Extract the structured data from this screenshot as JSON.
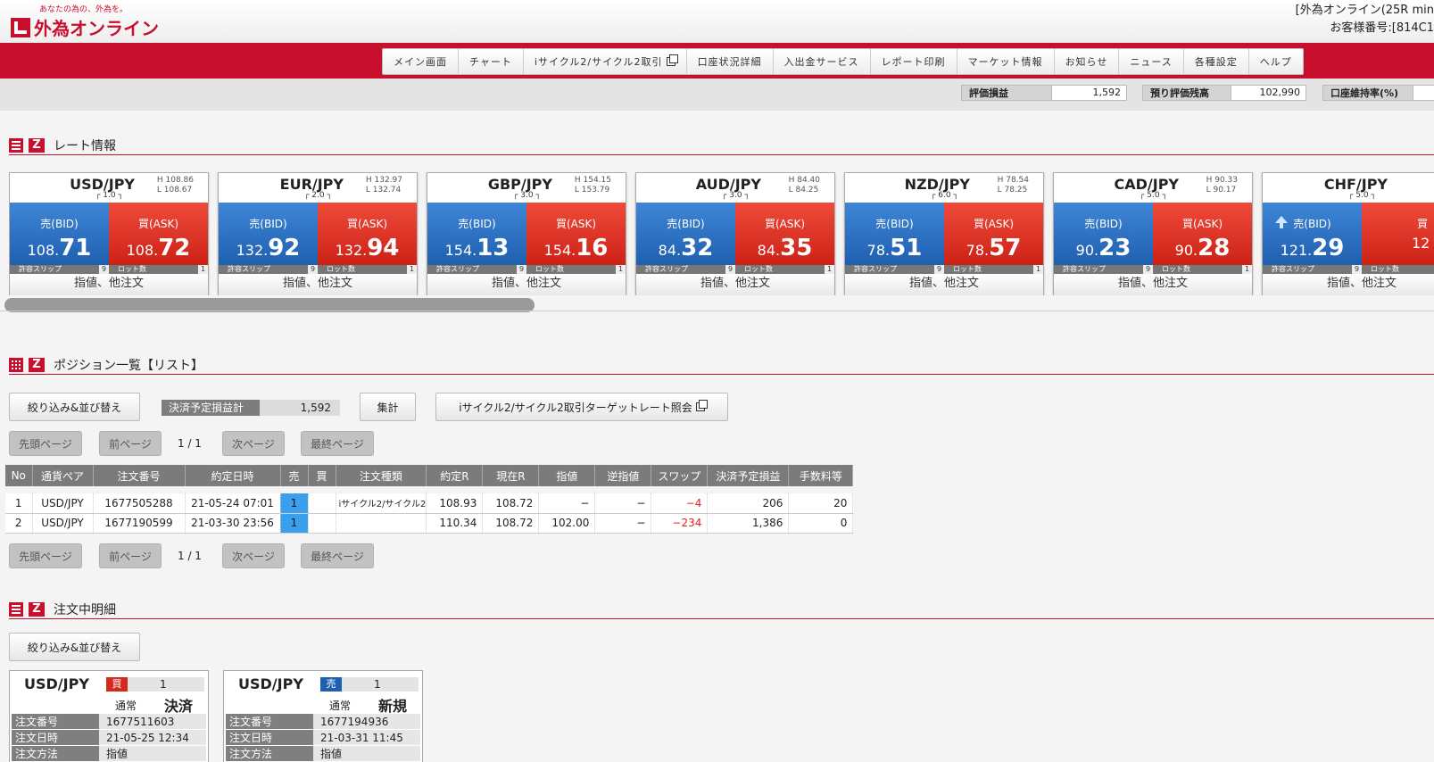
{
  "header": {
    "tagline": "あなたの為の、外為を。",
    "logo_text": "外為オンライン",
    "account_line1": "[外為オンライン(25R min",
    "account_line2": "お客様番号:[814C1"
  },
  "nav": {
    "items": [
      "メイン画面",
      "チャート",
      "iサイクル2/サイクル2取引",
      "口座状況詳細",
      "入出金サービス",
      "レポート印刷",
      "マーケット情報",
      "お知らせ",
      "ニュース",
      "各種設定",
      "ヘルプ"
    ]
  },
  "summary": {
    "pl_label": "評価損益",
    "pl_value": "1,592",
    "balance_label": "預り評価残高",
    "balance_value": "102,990",
    "margin_label": "口座維持率(%)"
  },
  "rates": {
    "title": "レート情報",
    "bid_label": "売(BID)",
    "ask_label": "買(ASK)",
    "slip_label": "許容スリップ",
    "lot_label": "ロット数",
    "order_link": "指値、他注文",
    "cards": [
      {
        "pair": "USD/JPY",
        "high": "H 108.86",
        "low": "L 108.67",
        "spread": "1.0",
        "bid_int": "108.",
        "bid_dec": "71",
        "ask_int": "108.",
        "ask_dec": "72",
        "slip": "9",
        "lot": "1"
      },
      {
        "pair": "EUR/JPY",
        "high": "H 132.97",
        "low": "L 132.74",
        "spread": "2.0",
        "bid_int": "132.",
        "bid_dec": "92",
        "ask_int": "132.",
        "ask_dec": "94",
        "slip": "9",
        "lot": "1"
      },
      {
        "pair": "GBP/JPY",
        "high": "H 154.15",
        "low": "L 153.79",
        "spread": "3.0",
        "bid_int": "154.",
        "bid_dec": "13",
        "ask_int": "154.",
        "ask_dec": "16",
        "slip": "9",
        "lot": "1"
      },
      {
        "pair": "AUD/JPY",
        "high": "H 84.40",
        "low": "L 84.25",
        "spread": "3.0",
        "bid_int": "84.",
        "bid_dec": "32",
        "ask_int": "84.",
        "ask_dec": "35",
        "slip": "9",
        "lot": "1"
      },
      {
        "pair": "NZD/JPY",
        "high": "H 78.54",
        "low": "L 78.25",
        "spread": "6.0",
        "bid_int": "78.",
        "bid_dec": "51",
        "ask_int": "78.",
        "ask_dec": "57",
        "slip": "9",
        "lot": "1"
      },
      {
        "pair": "CAD/JPY",
        "high": "H 90.33",
        "low": "L 90.17",
        "spread": "5.0",
        "bid_int": "90.",
        "bid_dec": "23",
        "ask_int": "90.",
        "ask_dec": "28",
        "slip": "9",
        "lot": "1"
      },
      {
        "pair": "CHF/JPY",
        "high": "",
        "low": "",
        "spread": "5.0",
        "bid_int": "121.",
        "bid_dec": "29",
        "ask_int": "12",
        "ask_dec": "",
        "slip": "9",
        "lot": "1"
      }
    ]
  },
  "positions": {
    "title": "ポジション一覧【リスト】",
    "filter_button": "絞り込み&並び替え",
    "settle_label": "決済予定損益計",
    "settle_value": "1,592",
    "aggregate_button": "集計",
    "target_button": "iサイクル2/サイクル2取引ターゲットレート照会",
    "first_page": "先頭ページ",
    "prev_page": "前ページ",
    "page_info": "1 / 1",
    "next_page": "次ページ",
    "last_page": "最終ページ",
    "columns": [
      "No",
      "通貨ペア",
      "注文番号",
      "約定日時",
      "売",
      "買",
      "注文種類",
      "約定R",
      "現在R",
      "指値",
      "逆指値",
      "スワップ",
      "決済予定損益",
      "手数料等"
    ],
    "rows": [
      {
        "no": "1",
        "pair": "USD/JPY",
        "order_no": "1677505288",
        "date": "21-05-24 07:01",
        "sell": "1",
        "buy": "",
        "type": "iサイクル2/サイクル2",
        "exec": "108.93",
        "current": "108.72",
        "limit": "−",
        "stop": "−",
        "swap": "−4",
        "pl": "206",
        "fee": "20"
      },
      {
        "no": "2",
        "pair": "USD/JPY",
        "order_no": "1677190599",
        "date": "21-03-30 23:56",
        "sell": "1",
        "buy": "",
        "type": "",
        "exec": "110.34",
        "current": "108.72",
        "limit": "102.00",
        "stop": "−",
        "swap": "−234",
        "pl": "1,386",
        "fee": "0"
      }
    ]
  },
  "orders": {
    "title": "注文中明細",
    "filter_button": "絞り込み&並び替え",
    "key_order_no": "注文番号",
    "key_order_date": "注文日時",
    "key_order_method": "注文方法",
    "cards": [
      {
        "pair": "USD/JPY",
        "side": "買",
        "qty": "1",
        "type": "通常",
        "action": "決済",
        "order_no": "1677511603",
        "date": "21-05-25 12:34",
        "method": "指値"
      },
      {
        "pair": "USD/JPY",
        "side": "売",
        "qty": "1",
        "type": "通常",
        "action": "新規",
        "order_no": "1677194936",
        "date": "21-03-31 11:45",
        "method": "指値"
      }
    ]
  },
  "colors": {
    "brand_red": "#c8102e",
    "bid_blue": "#2a6fc2",
    "ask_red": "#e03a2c",
    "negative": "#e0241a"
  }
}
